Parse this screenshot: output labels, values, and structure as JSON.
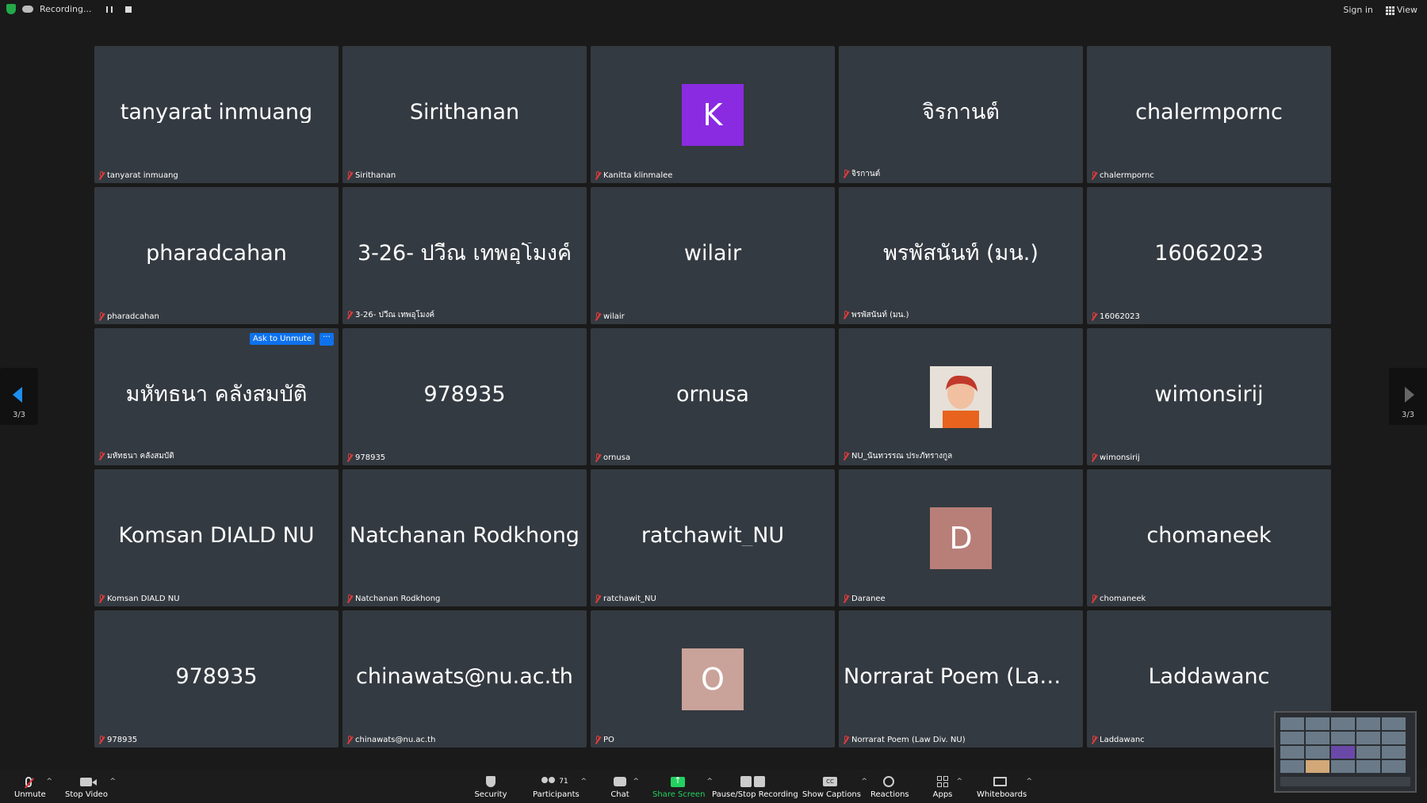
{
  "topbar": {
    "recording_label": "Recording...",
    "sign_in": "Sign in",
    "view": "View"
  },
  "pager": {
    "left_label": "3/3",
    "right_label": "3/3"
  },
  "tile_controls": {
    "ask_to_unmute": "Ask to Unmute",
    "more": "···"
  },
  "tiles": [
    {
      "display": "tanyarat inmuang",
      "name": "tanyarat inmuang"
    },
    {
      "display": "Sirithanan",
      "name": "Sirithanan"
    },
    {
      "display": "K",
      "name": "Kanitta klinmalee",
      "avatar_color": "#8a2be2"
    },
    {
      "display": "จิรกานต์",
      "name": "จิรกานต์"
    },
    {
      "display": "chalermpornc",
      "name": "chalermpornc"
    },
    {
      "display": "pharadcahan",
      "name": "pharadcahan"
    },
    {
      "display": "3-26- ปวีณ เทพอุโมงค์",
      "name": "3-26- ปวีณ เทพอุโมงค์"
    },
    {
      "display": "wilair",
      "name": "wilair"
    },
    {
      "display": "พรพัสนันท์ (มน.)",
      "name": "พรพัสนันท์ (มน.)"
    },
    {
      "display": "16062023",
      "name": "16062023"
    },
    {
      "display": "มหัทธนา คลังสมบัติ",
      "name": "มหัทธนา คลังสมบัติ"
    },
    {
      "display": "978935",
      "name": "978935"
    },
    {
      "display": "ornusa",
      "name": "ornusa"
    },
    {
      "display": "",
      "name": "NU_นันทวรรณ ประภัทรางกูล"
    },
    {
      "display": "wimonsirij",
      "name": "wimonsirij"
    },
    {
      "display": "Komsan DIALD NU",
      "name": "Komsan DIALD NU"
    },
    {
      "display": "Natchanan Rodkhong",
      "name": "Natchanan Rodkhong"
    },
    {
      "display": "ratchawit_NU",
      "name": "ratchawit_NU"
    },
    {
      "display": "D",
      "name": "Daranee",
      "avatar_color": "#b87f78"
    },
    {
      "display": "chomaneek",
      "name": "chomaneek"
    },
    {
      "display": "978935",
      "name": "978935"
    },
    {
      "display": "chinawats@nu.ac.th",
      "name": "chinawats@nu.ac.th"
    },
    {
      "display": "O",
      "name": "PO",
      "avatar_color": "#c9a39a"
    },
    {
      "display": "Norrarat Poem (Law D...",
      "name": "Norrarat Poem (Law Div. NU)"
    },
    {
      "display": "Laddawanc",
      "name": "Laddawanc"
    }
  ],
  "toolbar": {
    "unmute": "Unmute",
    "stop_video": "Stop Video",
    "security": "Security",
    "participants": "Participants",
    "participants_count": "71",
    "chat": "Chat",
    "share_screen": "Share Screen",
    "pause_stop_recording": "Pause/Stop Recording",
    "show_captions": "Show Captions",
    "reactions": "Reactions",
    "apps": "Apps",
    "whiteboards": "Whiteboards",
    "caret": "^",
    "cc": "CC"
  },
  "colors": {
    "accent_blue": "#0e72ed",
    "share_green": "#23d160",
    "muted_red": "#e23c3c"
  }
}
